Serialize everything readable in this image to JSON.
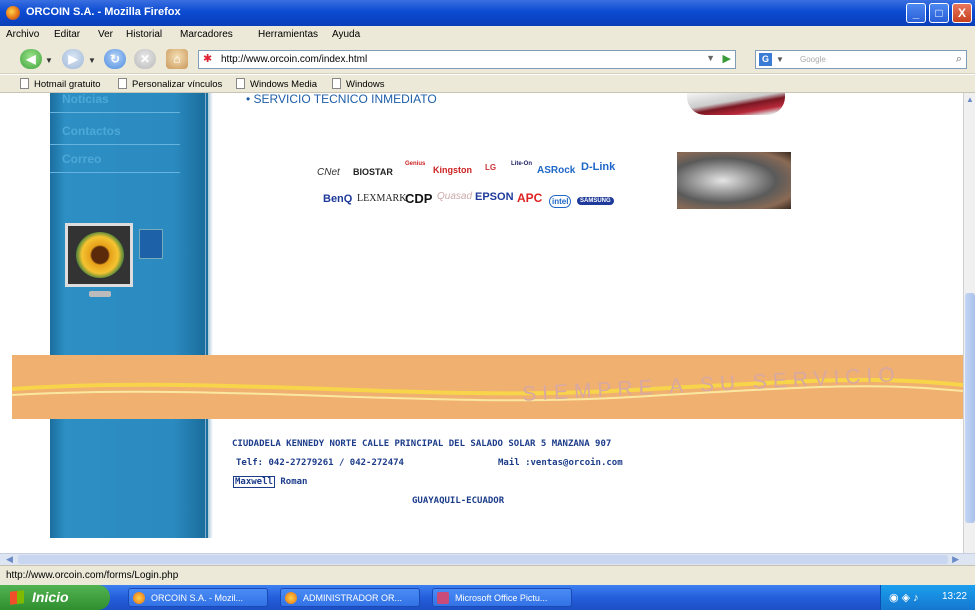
{
  "window": {
    "title": "ORCOIN S.A. - Mozilla Firefox",
    "minimize": "_",
    "maximize": "□",
    "close": "X"
  },
  "menu": [
    "Archivo",
    "Editar",
    "Ver",
    "Historial",
    "Marcadores",
    "Herramientas",
    "Ayuda"
  ],
  "nav": {
    "url": "http://www.orcoin.com/index.html",
    "search_placeholder": "Google"
  },
  "bookmarks": [
    "Hotmail gratuito",
    "Personalizar vínculos",
    "Windows Media",
    "Windows"
  ],
  "sidebar": {
    "items": [
      "Noticias",
      "Contactos",
      "Correo"
    ]
  },
  "content": {
    "service_line": "• SERVICIO TECNICO INMEDIATO",
    "brands_row1": [
      "CNet",
      "BIOSTAR",
      "Genius",
      "Kingston",
      "LG",
      "Lite-On",
      "ASRock",
      "D-Link"
    ],
    "brands_row2": [
      "BenQ",
      "LEXMARK",
      "CDP",
      "Quasad",
      "EPSON",
      "APC",
      "intel",
      "SAMSUNG"
    ],
    "slogan": "SIEMPRE A SU SERVICIO",
    "address": "CIUDADELA KENNEDY NORTE CALLE PRINCIPAL DEL SALADO SOLAR 5 MANZANA 907",
    "phone": "Telf: 042-27279261 / 042-272474",
    "mail": "Mail :ventas@orcoin.com",
    "credit_link": "Maxwell",
    "credit_name": "Roman",
    "city": "GUAYAQUIL-ECUADOR"
  },
  "status": "http://www.orcoin.com/forms/Login.php",
  "taskbar": {
    "start": "Inicio",
    "items": [
      "ORCOIN S.A. - Mozil...",
      "ADMINISTRADOR OR...",
      "Microsoft Office Pictu..."
    ],
    "clock": "13:22"
  },
  "colors": {
    "sidebar": "#2b8ac0",
    "banner": "#f0b070",
    "footer_text": "#1c3c8a"
  }
}
